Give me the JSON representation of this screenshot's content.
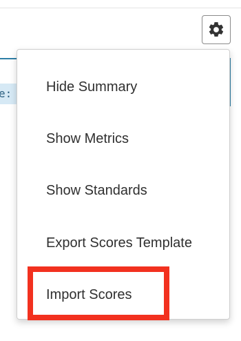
{
  "toolbar": {
    "settings_icon": "gear-icon"
  },
  "background": {
    "partial_label": "e:"
  },
  "menu": {
    "items": [
      {
        "label": "Hide Summary"
      },
      {
        "label": "Show Metrics"
      },
      {
        "label": "Show Standards"
      },
      {
        "label": "Export Scores Template"
      },
      {
        "label": "Import Scores"
      }
    ]
  },
  "annotation": {
    "highlighted_item": "Import Scores",
    "color": "#f2311f"
  },
  "colors": {
    "accent": "#2d7ea6",
    "chip_bg": "#d6e9f5",
    "text": "#2f2f2f"
  }
}
